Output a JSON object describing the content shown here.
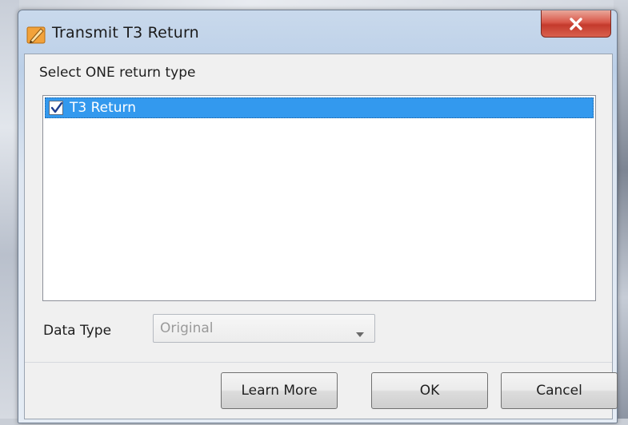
{
  "window": {
    "title": "Transmit T3 Return",
    "close_label": "close"
  },
  "form": {
    "prompt": "Select ONE return type",
    "return_types": [
      {
        "label": "T3 Return",
        "checked": true,
        "selected": true
      }
    ],
    "data_type_label": "Data Type",
    "data_type_value": "Original"
  },
  "buttons": {
    "learn_more": "Learn More",
    "ok": "OK",
    "cancel": "Cancel"
  },
  "colors": {
    "selection": "#3399ee",
    "close_button": "#d9584a",
    "title_bar": "#c9d9ec"
  },
  "icons": {
    "app": "transmit-app-icon",
    "close": "close-icon",
    "check": "checkmark-icon",
    "dropdown": "chevron-down-icon"
  }
}
